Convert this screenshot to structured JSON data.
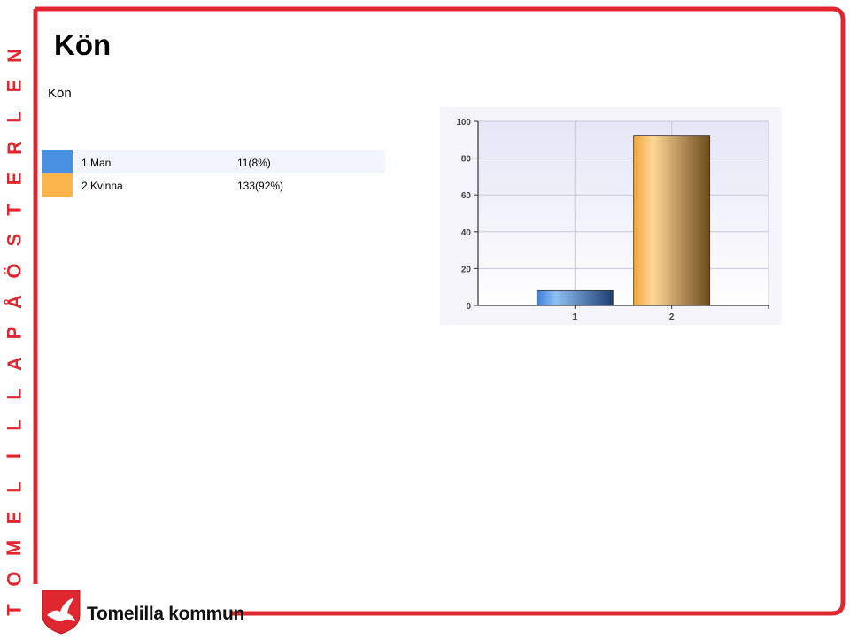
{
  "side_banner": {
    "letters": [
      "T",
      "O",
      "M",
      "E",
      "L",
      "I",
      "L",
      "L",
      "A",
      "P",
      "Å",
      "Ö",
      "S",
      "T",
      "E",
      "R",
      "L",
      "E",
      "N"
    ],
    "color": "#e0262e"
  },
  "page": {
    "title": "Kön",
    "section_title": "Kön"
  },
  "legend": [
    {
      "label": "1.Man",
      "value": "11(8%)",
      "color": "#4a90e2"
    },
    {
      "label": "2.Kvinna",
      "value": "133(92%)",
      "color": "#fbb54b"
    }
  ],
  "chart_data": {
    "type": "bar",
    "categories": [
      "1",
      "2"
    ],
    "values": [
      8,
      92
    ],
    "ylim": [
      0,
      100
    ],
    "yticks": [
      0,
      20,
      40,
      60,
      80,
      100
    ],
    "grid": true
  },
  "footer": {
    "brand": "Tomelilla kommun"
  }
}
